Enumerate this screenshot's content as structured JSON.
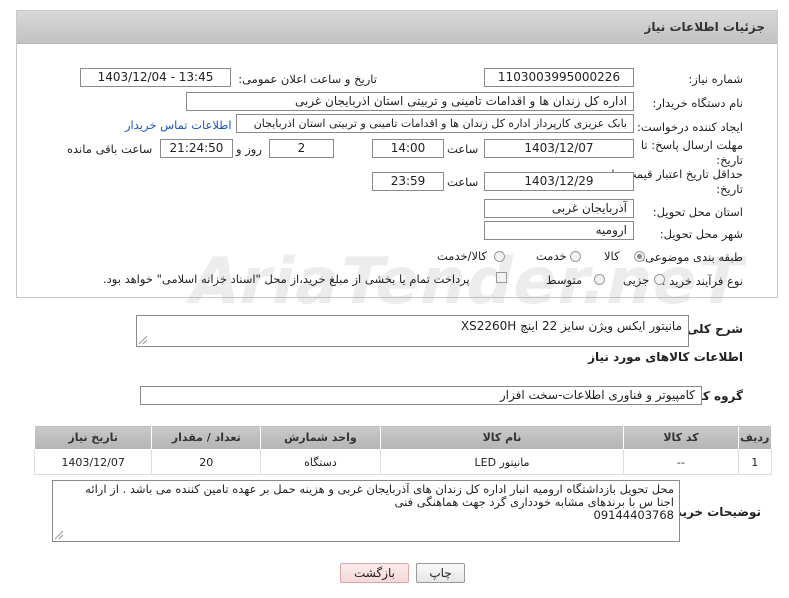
{
  "header": {
    "title": "جزئیات اطلاعات نیاز"
  },
  "form": {
    "need_number_label": "شماره نیاز:",
    "need_number": "1103003995000226",
    "announce_label": "تاریخ و ساعت اعلان عمومی:",
    "announce_value": "1403/12/04 - 13:45",
    "buyer_org_label": "نام دستگاه خریدار:",
    "buyer_org": "اداره کل زندان ها و اقدامات تامینی و تربیتی استان اذربایجان غربی",
    "creator_label": "ایجاد کننده درخواست:",
    "creator": "بابک عزیزی کارپرداز اداره کل زندان ها و اقدامات تامینی و تربیتی استان اذربایجان",
    "contact_link": "اطلاعات تماس خریدار",
    "reply_deadline_label_1": "مهلت ارسال پاسخ: تا",
    "reply_deadline_label_2": "تاریخ:",
    "reply_date": "1403/12/07",
    "time_label": "ساعت",
    "reply_time": "14:00",
    "days_value": "2",
    "days_label": "روز و",
    "remaining_time": "21:24:50",
    "remaining_label": "ساعت باقی مانده",
    "price_validity_label_1": "حداقل تاریخ اعتبار قیمت: تا",
    "price_validity_label_2": "تاریخ:",
    "validity_date": "1403/12/29",
    "validity_time": "23:59",
    "province_label": "استان محل تحویل:",
    "province": "آذربایجان غربی",
    "city_label": "شهر محل تحویل:",
    "city": "ارومیه",
    "category_label": "طبقه بندی موضوعی:",
    "category_options": [
      "کالا",
      "خدمت",
      "کالا/خدمت"
    ],
    "category_selected": "کالا",
    "process_label": "نوع فرآیند خرید :",
    "process_options": [
      "جزیی",
      "متوسط"
    ],
    "payment_note": "پرداخت تمام یا بخشی از مبلغ خرید،از محل \"اسناد خزانه اسلامی\" خواهد بود."
  },
  "watermark": "AriaTender.neT",
  "summary": {
    "label": "شرح کلی نیاز:",
    "value": "مانیتور ایکس ویژن   سایز 22 اینچ XS2260H"
  },
  "goods_info_title": "اطلاعات کالاهای مورد نیاز",
  "goods_group": {
    "label": "گروه کالا:",
    "value": "کامپیوتر و فناوری اطلاعات-سخت افزار"
  },
  "table": {
    "headers": [
      "ردیف",
      "کد کالا",
      "نام کالا",
      "واحد شمارش",
      "تعداد / مقدار",
      "تاریخ نیاز"
    ],
    "rows": [
      [
        "1",
        "--",
        "مانیتور LED",
        "دستگاه",
        "20",
        "1403/12/07"
      ]
    ]
  },
  "buyer_notes": {
    "label": "توضیحات خریدار:",
    "line1": "محل تحویل بازداشتگاه ارومیه انبار اداره کل زندان های  آذربایجان غربی و هزینه حمل بر عهده تامین کننده می باشد . از ارائه",
    "line2": "اجنا س با برندهای مشابه خودداری گرد جهت هماهنگی فنی",
    "line3": "09144403768"
  },
  "buttons": {
    "print": "چاپ",
    "back": "بازگشت"
  }
}
